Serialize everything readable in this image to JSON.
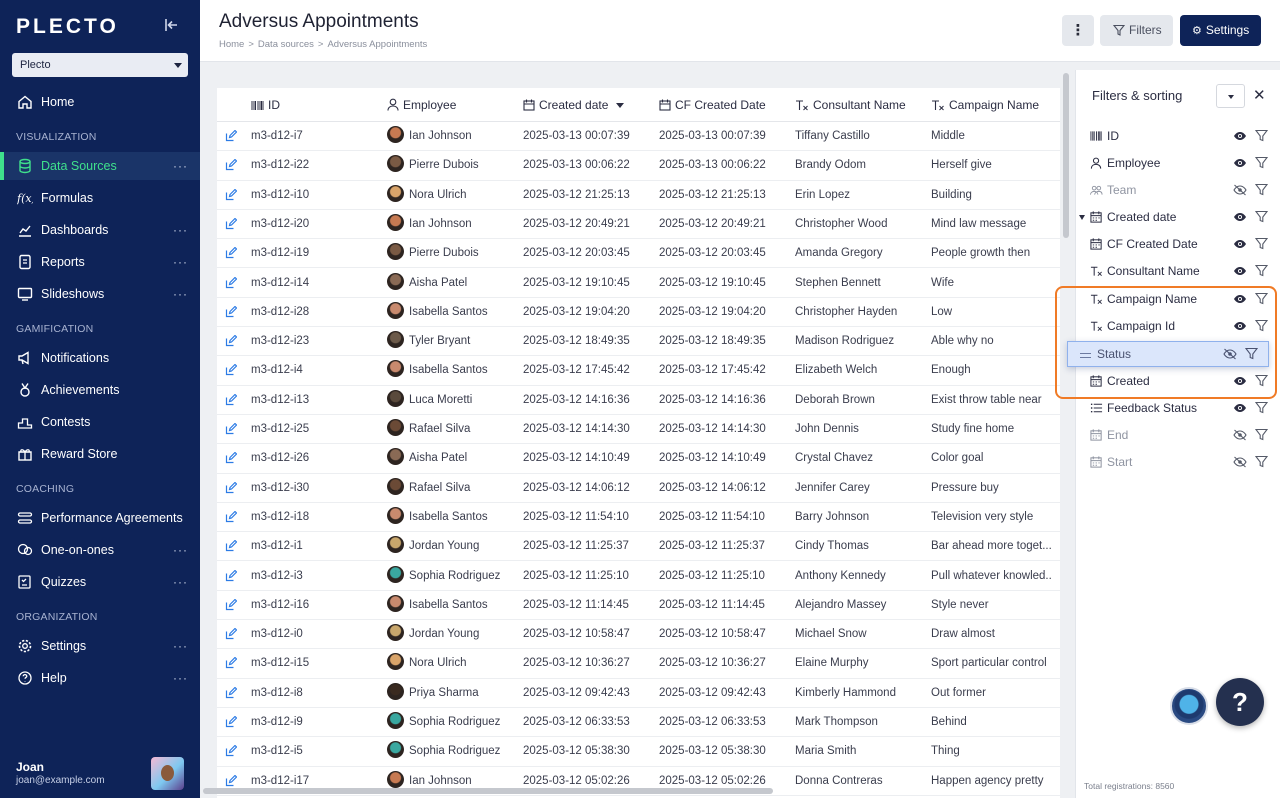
{
  "app": {
    "logo": "PLECTO",
    "org": "Plecto"
  },
  "nav": {
    "home": "Home",
    "sections": {
      "visualization": "VISUALIZATION",
      "gamification": "GAMIFICATION",
      "coaching": "COACHING",
      "organization": "ORGANIZATION"
    },
    "items": {
      "data_sources": "Data Sources",
      "formulas": "Formulas",
      "dashboards": "Dashboards",
      "reports": "Reports",
      "slideshows": "Slideshows",
      "notifications": "Notifications",
      "achievements": "Achievements",
      "contests": "Contests",
      "reward_store": "Reward Store",
      "performance_agreements": "Performance Agreements",
      "one_on_ones": "One-on-ones",
      "quizzes": "Quizzes",
      "settings": "Settings",
      "help": "Help"
    },
    "more": "···"
  },
  "user": {
    "name": "Joan",
    "email": "joan@example.com"
  },
  "header": {
    "title": "Adversus Appointments",
    "breadcrumb": [
      "Home",
      "Data sources",
      "Adversus Appointments"
    ],
    "breadcrumb_sep": ">",
    "more_label": "⋮",
    "filters_label": "Filters",
    "settings_label": "Settings"
  },
  "table": {
    "columns": [
      "ID",
      "Employee",
      "Created date",
      "CF Created Date",
      "Consultant Name",
      "Campaign Name"
    ],
    "rows": [
      [
        "m3-d12-i7",
        "Ian Johnson",
        "2025-03-13 00:07:39",
        "2025-03-13 00:07:39",
        "Tiffany Castillo",
        "Middle"
      ],
      [
        "m3-d12-i22",
        "Pierre Dubois",
        "2025-03-13 00:06:22",
        "2025-03-13 00:06:22",
        "Brandy Odom",
        "Herself give"
      ],
      [
        "m3-d12-i10",
        "Nora Ulrich",
        "2025-03-12 21:25:13",
        "2025-03-12 21:25:13",
        "Erin Lopez",
        "Building"
      ],
      [
        "m3-d12-i20",
        "Ian Johnson",
        "2025-03-12 20:49:21",
        "2025-03-12 20:49:21",
        "Christopher Wood",
        "Mind law message"
      ],
      [
        "m3-d12-i19",
        "Pierre Dubois",
        "2025-03-12 20:03:45",
        "2025-03-12 20:03:45",
        "Amanda Gregory",
        "People growth then"
      ],
      [
        "m3-d12-i14",
        "Aisha Patel",
        "2025-03-12 19:10:45",
        "2025-03-12 19:10:45",
        "Stephen Bennett",
        "Wife"
      ],
      [
        "m3-d12-i28",
        "Isabella Santos",
        "2025-03-12 19:04:20",
        "2025-03-12 19:04:20",
        "Christopher Hayden",
        "Low"
      ],
      [
        "m3-d12-i23",
        "Tyler Bryant",
        "2025-03-12 18:49:35",
        "2025-03-12 18:49:35",
        "Madison Rodriguez",
        "Able why no"
      ],
      [
        "m3-d12-i4",
        "Isabella Santos",
        "2025-03-12 17:45:42",
        "2025-03-12 17:45:42",
        "Elizabeth Welch",
        "Enough"
      ],
      [
        "m3-d12-i13",
        "Luca Moretti",
        "2025-03-12 14:16:36",
        "2025-03-12 14:16:36",
        "Deborah Brown",
        "Exist throw table near"
      ],
      [
        "m3-d12-i25",
        "Rafael Silva",
        "2025-03-12 14:14:30",
        "2025-03-12 14:14:30",
        "John Dennis",
        "Study fine home"
      ],
      [
        "m3-d12-i26",
        "Aisha Patel",
        "2025-03-12 14:10:49",
        "2025-03-12 14:10:49",
        "Crystal Chavez",
        "Color goal"
      ],
      [
        "m3-d12-i30",
        "Rafael Silva",
        "2025-03-12 14:06:12",
        "2025-03-12 14:06:12",
        "Jennifer Carey",
        "Pressure buy"
      ],
      [
        "m3-d12-i18",
        "Isabella Santos",
        "2025-03-12 11:54:10",
        "2025-03-12 11:54:10",
        "Barry Johnson",
        "Television very style"
      ],
      [
        "m3-d12-i1",
        "Jordan Young",
        "2025-03-12 11:25:37",
        "2025-03-12 11:25:37",
        "Cindy Thomas",
        "Bar ahead more toget..."
      ],
      [
        "m3-d12-i3",
        "Sophia Rodriguez",
        "2025-03-12 11:25:10",
        "2025-03-12 11:25:10",
        "Anthony Kennedy",
        "Pull whatever knowled..."
      ],
      [
        "m3-d12-i16",
        "Isabella Santos",
        "2025-03-12 11:14:45",
        "2025-03-12 11:14:45",
        "Alejandro Massey",
        "Style never"
      ],
      [
        "m3-d12-i0",
        "Jordan Young",
        "2025-03-12 10:58:47",
        "2025-03-12 10:58:47",
        "Michael Snow",
        "Draw almost"
      ],
      [
        "m3-d12-i15",
        "Nora Ulrich",
        "2025-03-12 10:36:27",
        "2025-03-12 10:36:27",
        "Elaine Murphy",
        "Sport particular control"
      ],
      [
        "m3-d12-i8",
        "Priya Sharma",
        "2025-03-12 09:42:43",
        "2025-03-12 09:42:43",
        "Kimberly Hammond",
        "Out former"
      ],
      [
        "m3-d12-i9",
        "Sophia Rodriguez",
        "2025-03-12 06:33:53",
        "2025-03-12 06:33:53",
        "Mark Thompson",
        "Behind"
      ],
      [
        "m3-d12-i5",
        "Sophia Rodriguez",
        "2025-03-12 05:38:30",
        "2025-03-12 05:38:30",
        "Maria Smith",
        "Thing"
      ],
      [
        "m3-d12-i17",
        "Ian Johnson",
        "2025-03-12 05:02:26",
        "2025-03-12 05:02:26",
        "Donna Contreras",
        "Happen agency pretty"
      ]
    ],
    "avatar_colors": {
      "Ian Johnson": "#c77a52",
      "Pierre Dubois": "#7a5a44",
      "Nora Ulrich": "#d9a46a",
      "Aisha Patel": "#8a6a55",
      "Isabella Santos": "#c98a6e",
      "Tyler Bryant": "#6c5a4a",
      "Luca Moretti": "#5a4a3c",
      "Rafael Silva": "#6b4a36",
      "Jordan Young": "#c9a76c",
      "Sophia Rodriguez": "#3aa8a0",
      "Priya Sharma": "#3a2a20"
    }
  },
  "panel": {
    "title": "Filters & sorting",
    "close_label": "✕",
    "fields": [
      {
        "label": "ID",
        "icon": "barcode-icon",
        "visible": true
      },
      {
        "label": "Employee",
        "icon": "person-icon",
        "visible": true
      },
      {
        "label": "Team",
        "icon": "team-icon",
        "visible": false
      },
      {
        "label": "Created date",
        "icon": "calendar-icon",
        "visible": true,
        "sorted": true
      },
      {
        "label": "CF Created Date",
        "icon": "calendar-icon",
        "visible": true
      },
      {
        "label": "Consultant Name",
        "icon": "text-icon",
        "visible": true
      },
      {
        "label": "Campaign Name",
        "icon": "text-icon",
        "visible": true
      },
      {
        "label": "Campaign Id",
        "icon": "text-icon",
        "visible": true
      },
      {
        "label": "Created",
        "icon": "calendar-icon",
        "visible": true
      },
      {
        "label": "Feedback Status",
        "icon": "list-icon",
        "visible": true
      },
      {
        "label": "End",
        "icon": "calendar-icon",
        "visible": false
      },
      {
        "label": "Start",
        "icon": "calendar-icon",
        "visible": false
      }
    ],
    "dragging": {
      "label": "Status",
      "visible": false
    },
    "total": "Total registrations: 8560"
  },
  "help": {
    "label": "?"
  },
  "colors": {
    "sidebar": "#0e2358",
    "accent_green": "#3fe08c",
    "link_blue": "#2c7be5",
    "highlight_orange": "#f07b26"
  }
}
